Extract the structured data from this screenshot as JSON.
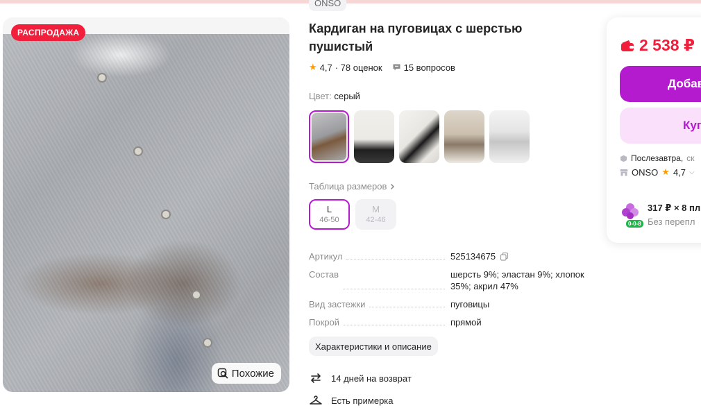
{
  "product": {
    "brand": "ONSO",
    "title": "Кардиган на пуговицах с шерстью пушистый",
    "sale_badge": "РАСПРОДАЖА",
    "similar_label": "Похожие",
    "rating": "4,7",
    "ratings_count": "· 78 оценок",
    "questions": "15 вопросов"
  },
  "color": {
    "label": "Цвет:",
    "value": "серый",
    "swatches": [
      "серый",
      "вариант 2",
      "вариант 3",
      "вариант 4",
      "вариант 5"
    ]
  },
  "sizes": {
    "table_link": "Таблица размеров",
    "items": [
      {
        "size": "L",
        "range": "46-50",
        "selected": true
      },
      {
        "size": "M",
        "range": "42-46",
        "selected": false
      }
    ]
  },
  "specs": [
    {
      "key": "Артикул",
      "value": "525134675"
    },
    {
      "key": "Состав",
      "value": "шерсть 9%; эластан 9%; хлопок 35%; акрил 47%"
    },
    {
      "key": "Вид застежки",
      "value": "пуговицы"
    },
    {
      "key": "Покрой",
      "value": "прямой"
    }
  ],
  "characteristics_button": "Характеристики и описание",
  "features": [
    {
      "label": "14 дней на возврат",
      "icon": "return-arrows-icon"
    },
    {
      "label": "Есть примерка",
      "icon": "hanger-icon"
    }
  ],
  "buy_card": {
    "price": "2 538 ₽",
    "add_label": "Добав",
    "buy_label": "Куп",
    "delivery": "Послезавтра,",
    "delivery_muted": "ск",
    "seller": "ONSO",
    "seller_rating": "4,7",
    "installment_line1": "317 ₽ × 8 пл",
    "installment_line2": "Без перепл",
    "installment_badge": "0-0-8"
  },
  "colors": {
    "accent": "#b41bcf",
    "price": "#f21f3c",
    "sale": "#f21f3c",
    "star": "#ff9d00"
  }
}
